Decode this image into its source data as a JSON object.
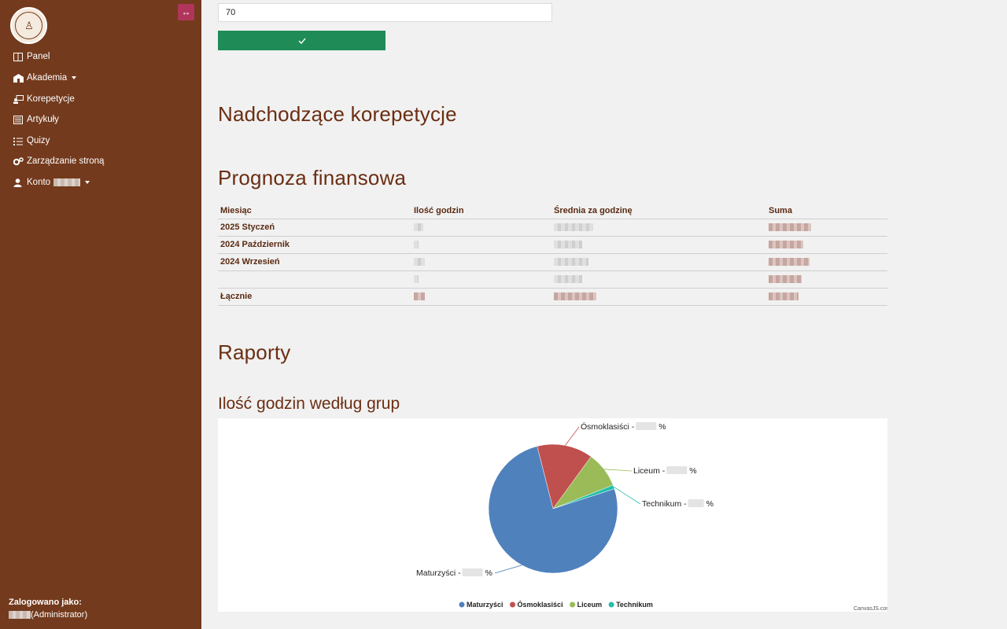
{
  "sidebar": {
    "toggle_symbol": "↔",
    "logo_icon": "academy-seal-icon",
    "items": [
      {
        "label": "Panel",
        "icon": "panel-icon"
      },
      {
        "label": "Akademia",
        "icon": "academy-icon",
        "dropdown": true
      },
      {
        "label": "Korepetycje",
        "icon": "tutoring-icon"
      },
      {
        "label": "Artykuły",
        "icon": "articles-icon"
      },
      {
        "label": "Quizy",
        "icon": "quiz-icon"
      },
      {
        "label": "Zarządzanie stroną",
        "icon": "cogs-icon"
      },
      {
        "label": "Konto",
        "icon": "user-icon",
        "dropdown": true
      }
    ],
    "footer": {
      "logged_as_label": "Zalogowano jako:",
      "role": "(Administrator)"
    }
  },
  "form": {
    "amount_value": "70",
    "confirm_symbol": "✓"
  },
  "headings": {
    "upcoming": "Nadchodzące korepetycje",
    "forecast": "Prognoza finansowa",
    "reports": "Raporty",
    "hours_by_group": "Ilość godzin według grup"
  },
  "finance_table": {
    "columns": [
      "Miesiąc",
      "Ilość godzin",
      "Średnia za godzinę",
      "Suma"
    ],
    "rows": [
      {
        "month": "2025 Styczeń"
      },
      {
        "month": "2024 Październik"
      },
      {
        "month": "2024 Wrzesień"
      },
      {
        "month": ""
      },
      {
        "month": "Łącznie"
      }
    ]
  },
  "chart_data": {
    "type": "pie",
    "categories": [
      "Maturzyści",
      "Ósmoklasiści",
      "Liceum",
      "Technikum"
    ],
    "values": [
      76,
      14,
      9,
      1
    ],
    "colors": [
      "#4f81bc",
      "#c0504e",
      "#9bbb58",
      "#23bfaa"
    ],
    "label_suffix": "%",
    "label_separator": " - ",
    "legend_position": "bottom",
    "credit": "CanvasJS.com"
  }
}
